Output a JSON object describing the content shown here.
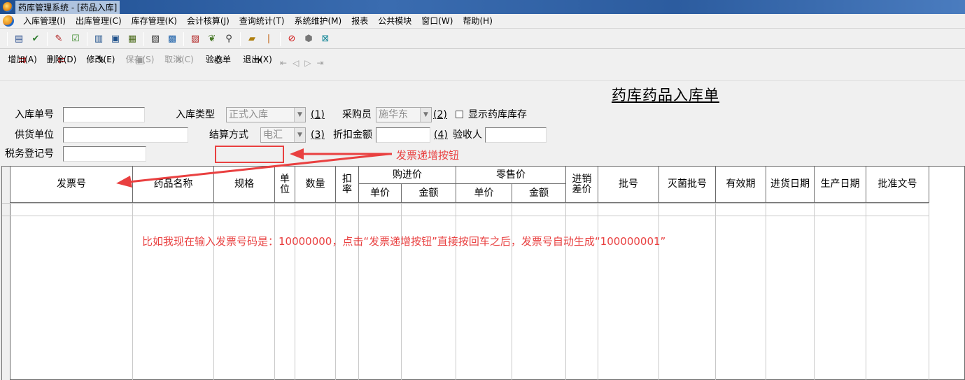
{
  "window": {
    "title": "药库管理系统 - [药品入库]"
  },
  "menu": [
    "入库管理(I)",
    "出库管理(C)",
    "库存管理(K)",
    "会计核算(J)",
    "查询统计(T)",
    "系统维护(M)",
    "报表",
    "公共模块",
    "窗口(W)",
    "帮助(H)"
  ],
  "toolbar1_icons": [
    "document-icon",
    "check-doc-icon",
    "edit-doc-icon",
    "approve-icon",
    "clipboard-icon",
    "id-card-icon",
    "ledger-icon",
    "report-icon",
    "calculator-icon",
    "chart-doc-icon",
    "tree-icon",
    "search-icon",
    "folder-icon",
    "thermometer-icon",
    "stop-icon",
    "eraser-icon",
    "exit-icon"
  ],
  "toolbar2": {
    "add": "增加(A)",
    "delete": "删除(D)",
    "modify": "修改(E)",
    "save": "保存(S)",
    "cancel": "取消(C)",
    "receipt": "验收单",
    "exit": "退出(X)"
  },
  "form": {
    "title": "药库药品入库单",
    "entry_no_label": "入库单号",
    "entry_type_label": "入库类型",
    "entry_type_value": "正式入库",
    "hint1": "(1)",
    "buyer_label": "采购员",
    "buyer_value": "施华东",
    "hint2": "(2)",
    "show_stock_label": "显示药库库存",
    "supplier_label": "供货单位",
    "settle_label": "结算方式",
    "settle_value": "电汇",
    "hint3": "(3)",
    "discount_label": "折扣金额",
    "hint4": "(4)",
    "inspector_label": "验收人",
    "tax_label": "税务登记号"
  },
  "annotations": {
    "button_label": "发票递增按钮",
    "note": "比如我现在输入发票号码是：10000000，点击“发票递增按钮”直接按回车之后，发票号自动生成“100000001”"
  },
  "table": {
    "invoice": "发票号",
    "drug_name": "药品名称",
    "spec": "规格",
    "unit": "单位",
    "qty": "数量",
    "discount_rate": "扣率",
    "purchase_price": "购进价",
    "unit_price": "单价",
    "amount": "金额",
    "retail_price": "零售价",
    "price_diff": "进销差价",
    "batch": "批号",
    "sterile_batch": "灭菌批号",
    "expiry": "有效期",
    "purchase_date": "进货日期",
    "production_date": "生产日期",
    "approval_no": "批准文号"
  },
  "colors": {
    "annotation_red": "#e94040"
  }
}
